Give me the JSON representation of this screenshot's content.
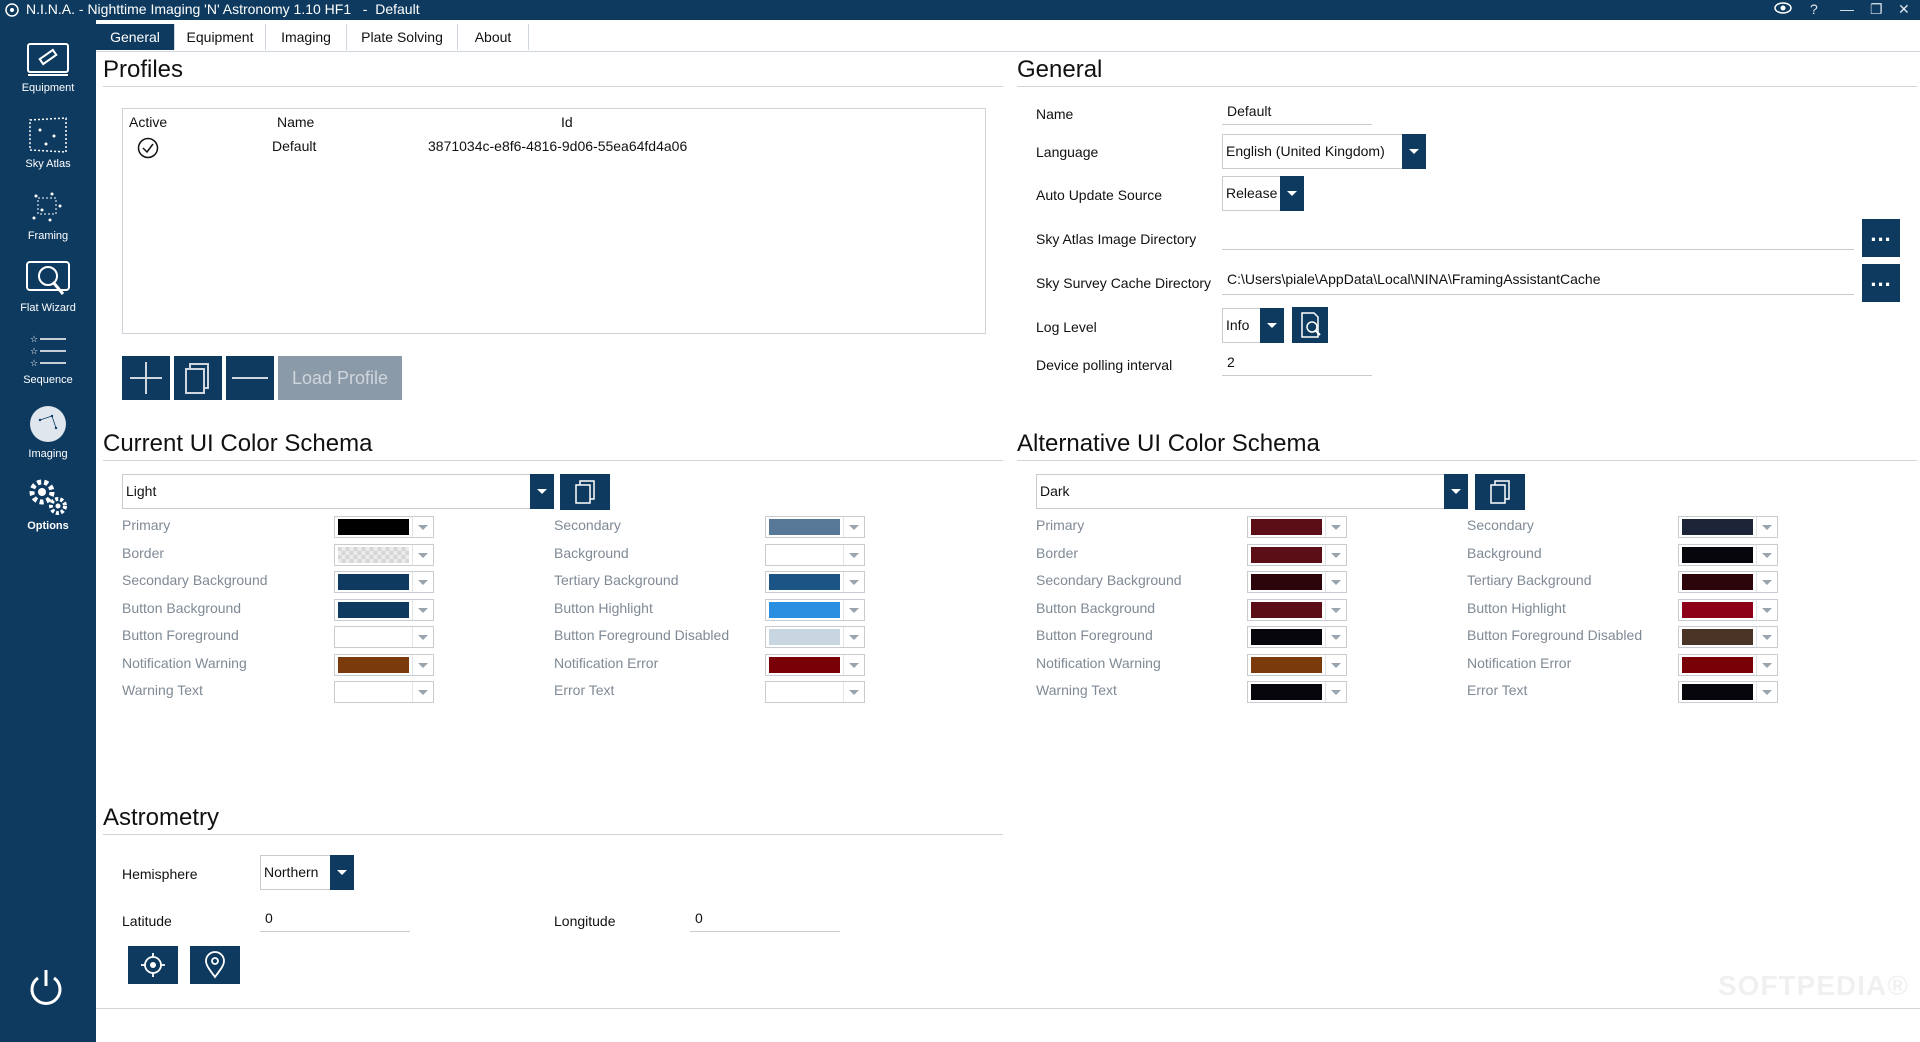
{
  "window": {
    "title": "N.I.N.A. - Nighttime Imaging 'N' Astronomy 1.10 HF1   -  Default"
  },
  "nav": {
    "items": [
      {
        "label": "Equipment"
      },
      {
        "label": "Sky Atlas"
      },
      {
        "label": "Framing"
      },
      {
        "label": "Flat Wizard"
      },
      {
        "label": "Sequence"
      },
      {
        "label": "Imaging"
      },
      {
        "label": "Options"
      }
    ]
  },
  "tabs": [
    "General",
    "Equipment",
    "Imaging",
    "Plate Solving",
    "About"
  ],
  "profiles": {
    "title": "Profiles",
    "columns": [
      "Active",
      "Name",
      "Id"
    ],
    "rows": [
      {
        "name": "Default",
        "id": "3871034c-e8f6-4816-9d06-55ea64fd4a06"
      }
    ],
    "load_label": "Load Profile"
  },
  "general": {
    "title": "General",
    "name_label": "Name",
    "name_value": "Default",
    "language_label": "Language",
    "language_value": "English (United Kingdom)",
    "update_label": "Auto Update Source",
    "update_value": "Release",
    "sky_atlas_label": "Sky Atlas Image Directory",
    "sky_atlas_value": "",
    "survey_label": "Sky Survey Cache Directory",
    "survey_value": "C:\\Users\\piale\\AppData\\Local\\NINA\\FramingAssistantCache",
    "log_label": "Log Level",
    "log_value": "Info",
    "polling_label": "Device polling interval",
    "polling_value": "2",
    "browse_label": "..."
  },
  "current_schema": {
    "title": "Current UI Color Schema",
    "selected": "Light",
    "left": [
      {
        "label": "Primary",
        "color": "#000000"
      },
      {
        "label": "Border",
        "color": "#d4d4d4"
      },
      {
        "label": "Secondary Background",
        "color": "#0e3a5f"
      },
      {
        "label": "Button Background",
        "color": "#0e3a5f"
      },
      {
        "label": "Button Foreground",
        "color": "#ffffff"
      },
      {
        "label": "Notification Warning",
        "color": "#7a3a0c"
      },
      {
        "label": "Warning Text",
        "color": "#ffffff"
      }
    ],
    "right": [
      {
        "label": "Secondary",
        "color": "#587898"
      },
      {
        "label": "Background",
        "color": "#ffffff"
      },
      {
        "label": "Tertiary Background",
        "color": "#1a5585"
      },
      {
        "label": "Button Highlight",
        "color": "#2a8fe0"
      },
      {
        "label": "Button Foreground Disabled",
        "color": "#c8d6e2"
      },
      {
        "label": "Notification Error",
        "color": "#7a0008"
      },
      {
        "label": "Error Text",
        "color": "#ffffff"
      }
    ]
  },
  "alt_schema": {
    "title": "Alternative UI Color Schema",
    "selected": "Dark",
    "left": [
      {
        "label": "Primary",
        "color": "#5c0e16"
      },
      {
        "label": "Border",
        "color": "#5c0e16"
      },
      {
        "label": "Secondary Background",
        "color": "#2c050a"
      },
      {
        "label": "Button Background",
        "color": "#5c0e16"
      },
      {
        "label": "Button Foreground",
        "color": "#06060c"
      },
      {
        "label": "Notification Warning",
        "color": "#7a3a0c"
      },
      {
        "label": "Warning Text",
        "color": "#06060c"
      }
    ],
    "right": [
      {
        "label": "Secondary",
        "color": "#1e2438"
      },
      {
        "label": "Background",
        "color": "#06060c"
      },
      {
        "label": "Tertiary Background",
        "color": "#2c050a"
      },
      {
        "label": "Button Highlight",
        "color": "#8e0018"
      },
      {
        "label": "Button Foreground Disabled",
        "color": "#4a3426"
      },
      {
        "label": "Notification Error",
        "color": "#7a0008"
      },
      {
        "label": "Error Text",
        "color": "#06060c"
      }
    ]
  },
  "astrometry": {
    "title": "Astrometry",
    "hemisphere_label": "Hemisphere",
    "hemisphere_value": "Northern",
    "latitude_label": "Latitude",
    "latitude_value": "0",
    "longitude_label": "Longitude",
    "longitude_value": "0"
  },
  "watermark": "SOFTPEDIA®"
}
